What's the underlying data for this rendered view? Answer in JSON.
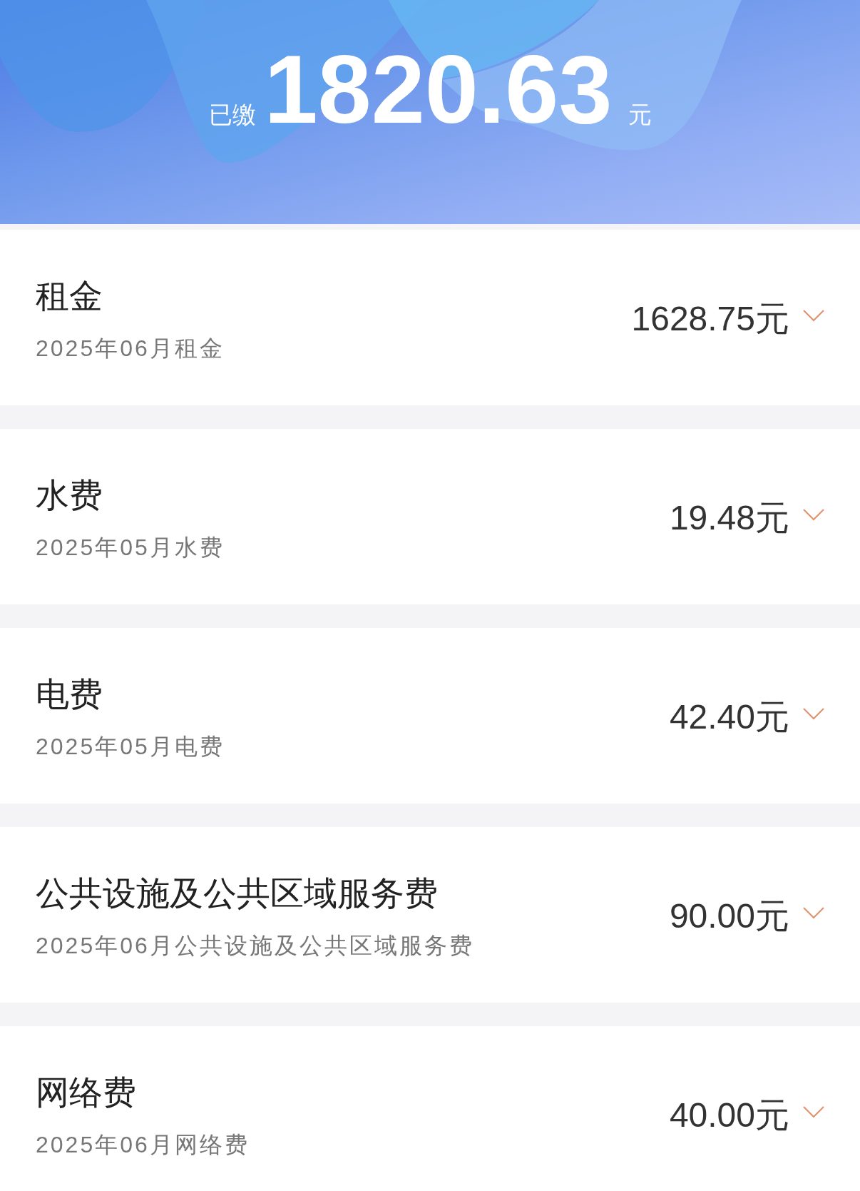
{
  "header": {
    "label": "已缴",
    "amount": "1820.63",
    "unit": "元"
  },
  "bills": [
    {
      "name": "租金",
      "period": "2025年06月租金",
      "amount": "1628.75元",
      "expanded": false
    },
    {
      "name": "水费",
      "period": "2025年05月水费",
      "amount": "19.48元",
      "expanded": false
    },
    {
      "name": "电费",
      "period": "2025年05月电费",
      "amount": "42.40元",
      "expanded": false
    },
    {
      "name": "公共设施及公共区域服务费",
      "period": "2025年06月公共设施及公共区域服务费",
      "amount": "90.00元",
      "expanded": false
    },
    {
      "name": "网络费",
      "period": "2025年06月网络费",
      "amount": "40.00元",
      "expanded": false
    }
  ]
}
